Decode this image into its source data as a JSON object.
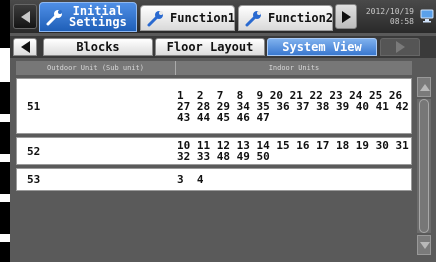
{
  "header": {
    "tabs": [
      {
        "line1": "Initial",
        "line2": "Settings",
        "active": true
      },
      {
        "label": "Function1",
        "active": false
      },
      {
        "label": "Function2",
        "active": false
      }
    ],
    "date": "2012/10/19",
    "time": "08:58",
    "nav_prev_icon": "triangle-left-icon",
    "nav_next_icon": "triangle-right-icon",
    "monitor_icon": "monitor-icon",
    "tab_icon": "wrench-icon"
  },
  "subtabs": [
    {
      "label": "Blocks",
      "active": false
    },
    {
      "label": "Floor Layout",
      "active": false
    },
    {
      "label": "System View",
      "active": true
    }
  ],
  "table": {
    "col_outdoor": "Outdoor Unit (Sub unit)",
    "col_indoor": "Indoor Units",
    "rows": [
      {
        "unit": "51",
        "lines": [
          "1  2  7  8  9 20 21 22 23 24 25 26",
          "27 28 29 34 35 36 37 38 39 40 41 42",
          "43 44 45 46 47"
        ]
      },
      {
        "unit": "52",
        "lines": [
          "10 11 12 13 14 15 16 17 18 19 30 31",
          "32 33 48 49 50"
        ]
      },
      {
        "unit": "53",
        "lines": [
          "3  4"
        ]
      }
    ]
  },
  "colors": {
    "accent_blue": "#1f5fb8",
    "panel_gray": "#5a5a5a"
  }
}
